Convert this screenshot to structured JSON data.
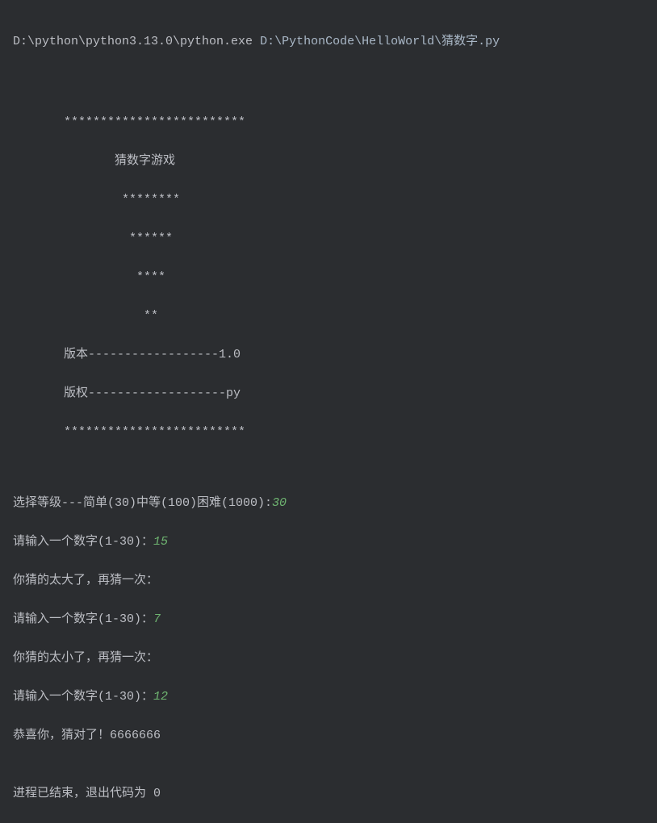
{
  "command": {
    "executable": "D:\\python\\python3.13.0\\python.exe",
    "script": "D:\\PythonCode\\HelloWorld\\猜数字.py"
  },
  "banner": {
    "line1": "       *************************",
    "line2": "              猜数字游戏",
    "line3": "               ********",
    "line4": "                ******",
    "line5": "                 ****",
    "line6": "                  **",
    "line7": "       版本------------------1.0",
    "line8": "       版权-------------------py",
    "line9": "       *************************"
  },
  "interaction": {
    "difficulty_prompt": "选择等级---简单(30)中等(100)困难(1000):",
    "difficulty_input": "30",
    "guess1_prompt": "请输入一个数字(1-30)：",
    "guess1_input": "15",
    "feedback1": "你猜的太大了，再猜一次：",
    "guess2_prompt": "请输入一个数字(1-30)：",
    "guess2_input": "7",
    "feedback2": "你猜的太小了，再猜一次：",
    "guess3_prompt": "请输入一个数字(1-30)：",
    "guess3_input": "12",
    "success": "恭喜你，猜对了！6666666"
  },
  "exit": {
    "message": "进程已结束，退出代码为 0"
  }
}
